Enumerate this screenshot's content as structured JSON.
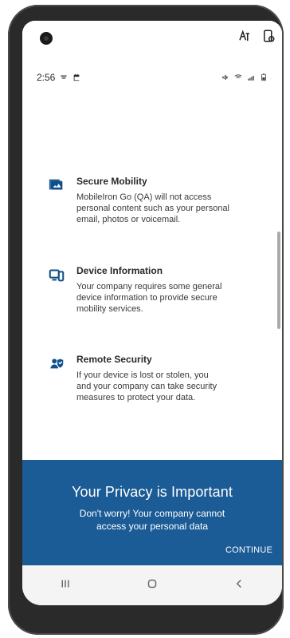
{
  "status_bar": {
    "time": "2:56"
  },
  "features": [
    {
      "title": "Secure Mobility",
      "description": "MobileIron Go (QA) will not access\npersonal content such as your personal\nemail, photos or voicemail.",
      "icon": "photos-icon"
    },
    {
      "title": "Device Information",
      "description": "Your company requires some general\ndevice information to provide secure\nmobility services.",
      "icon": "devices-icon"
    },
    {
      "title": "Remote Security",
      "description": "If your device is lost or stolen, you\nand your company can take security\nmeasures to protect your data.",
      "icon": "user-shield-icon"
    }
  ],
  "privacy_panel": {
    "headline": "Your Privacy is Important",
    "subtext": "Don't worry! Your company cannot\naccess your personal data",
    "continue_label": "CONTINUE"
  },
  "navigation": {
    "items": [
      {
        "icon": "recent-apps-icon"
      },
      {
        "icon": "home-icon"
      },
      {
        "icon": "back-icon"
      }
    ]
  },
  "colors": {
    "brand_blue": "#1b5b96",
    "icon_blue": "#0f4f8b"
  }
}
